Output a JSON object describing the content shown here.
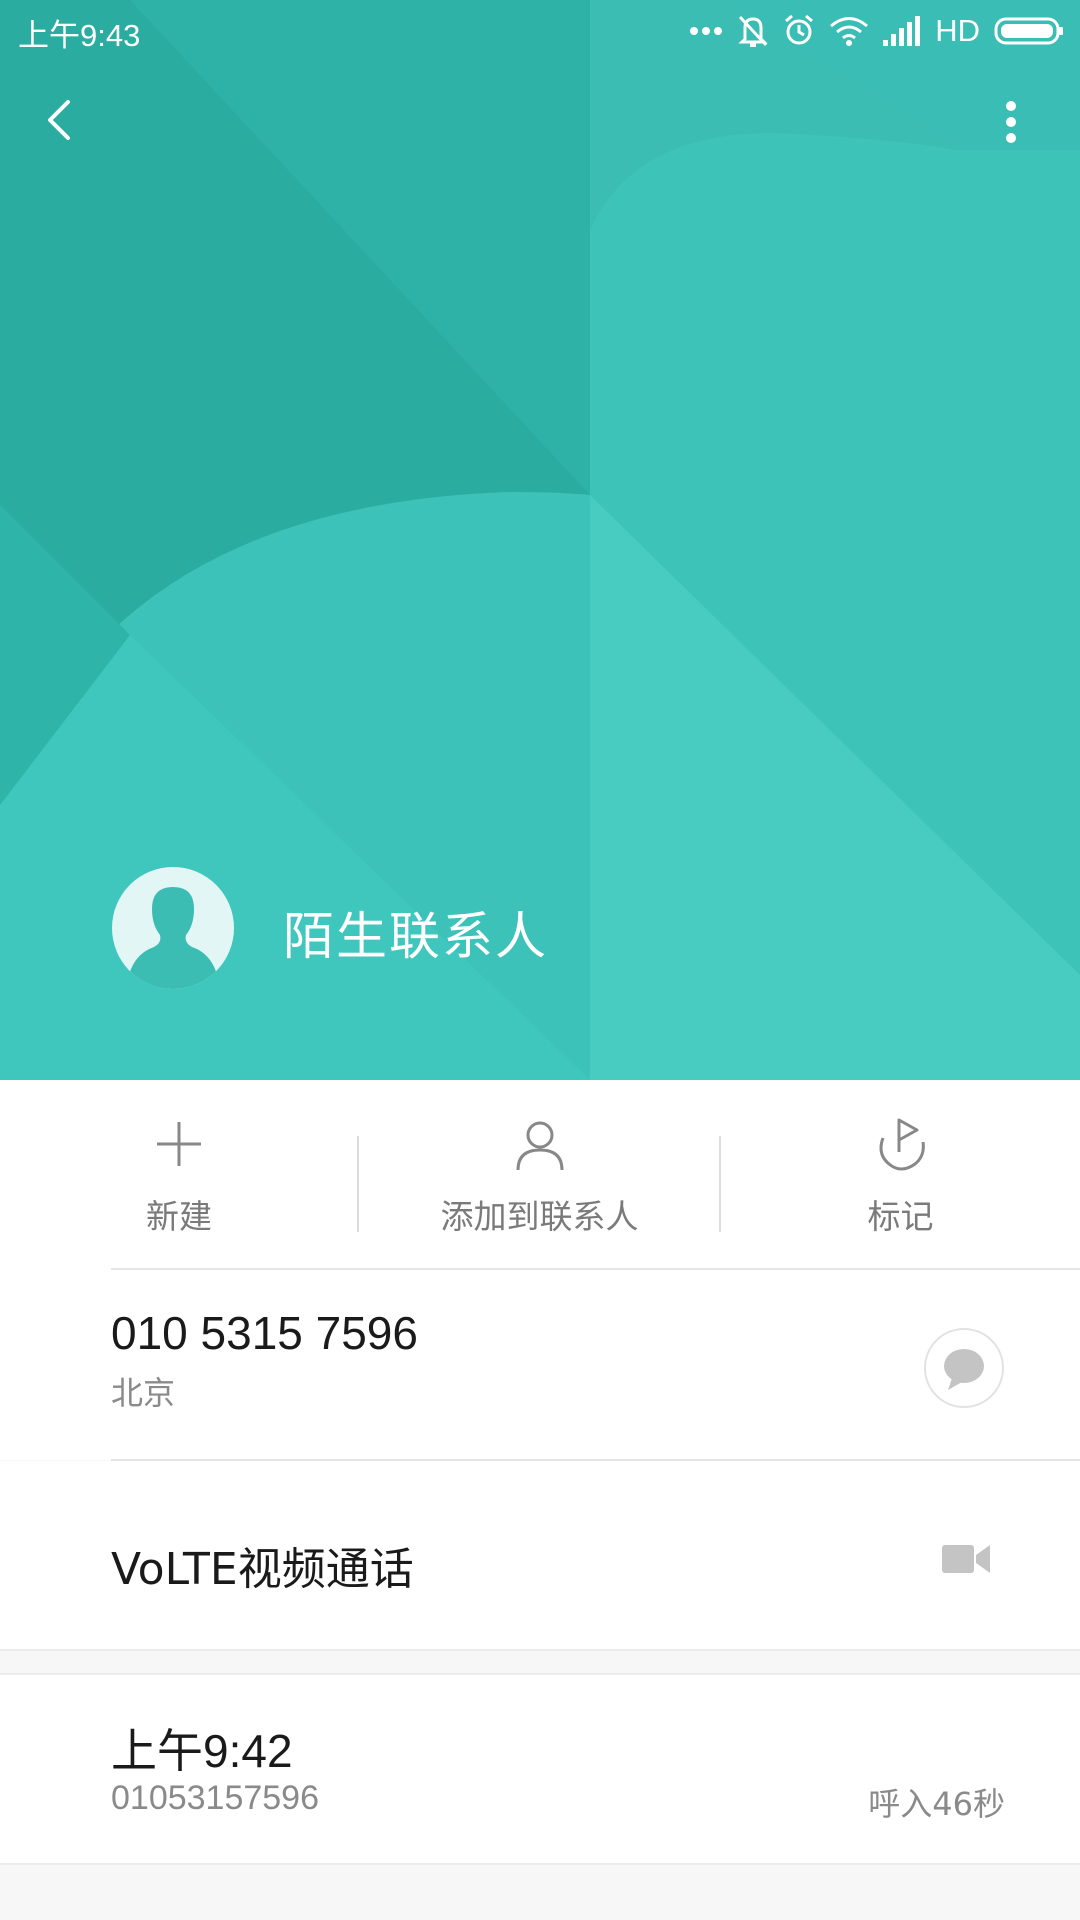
{
  "status_bar": {
    "time": "上午9:43",
    "network": "HD",
    "icons": [
      "more-dots-icon",
      "mute-icon",
      "alarm-icon",
      "wifi-icon",
      "signal-icon",
      "battery-icon"
    ]
  },
  "toolbar": {
    "back_icon": "back-arrow-icon",
    "more_icon": "more-vertical-icon"
  },
  "contact": {
    "name": "陌生联系人",
    "avatar_icon": "person-silhouette-icon"
  },
  "actions": [
    {
      "label": "新建",
      "icon": "plus-icon"
    },
    {
      "label": "添加到联系人",
      "icon": "person-icon"
    },
    {
      "label": "标记",
      "icon": "flag-icon"
    }
  ],
  "number_row": {
    "number": "010 5315 7596",
    "location": "北京",
    "message_icon": "message-bubble-icon"
  },
  "video_row": {
    "label": "VoLTE视频通话",
    "icon": "video-camera-icon"
  },
  "call_log": [
    {
      "time": "上午9:42",
      "number": "01053157596",
      "status": "呼入46秒"
    }
  ],
  "colors": {
    "header": "#2fb5aa",
    "header_light": "#45c9c0",
    "text_primary": "#1a1a1a",
    "text_secondary": "#8a8a8a",
    "icon_gray": "#888888"
  }
}
